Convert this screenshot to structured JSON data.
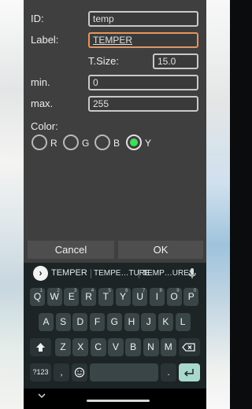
{
  "form": {
    "id_label": "ID:",
    "id_value": "temp",
    "label_label": "Label:",
    "label_value": "TEMPER",
    "tsize_label": "T.Size:",
    "tsize_value": "15.0",
    "min_label": "min.",
    "min_value": "0",
    "max_label": "max.",
    "max_value": "255",
    "color_label": "Color:",
    "colors": [
      {
        "label": "R",
        "checked": false
      },
      {
        "label": "G",
        "checked": false
      },
      {
        "label": "B",
        "checked": false
      },
      {
        "label": "Y",
        "checked": true
      }
    ],
    "selected_color_accent": "#3ee05a"
  },
  "dialog_buttons": {
    "cancel": "Cancel",
    "ok": "OK"
  },
  "keyboard": {
    "suggestions": [
      "TEMPER",
      "TEMPE…TURE",
      "TEMP…URES"
    ],
    "suggestion_icon": "chevron-right-icon",
    "mic_icon": "mic-icon",
    "row1": [
      {
        "k": "Q",
        "h": "1"
      },
      {
        "k": "W",
        "h": "2"
      },
      {
        "k": "E",
        "h": "3"
      },
      {
        "k": "R",
        "h": "4"
      },
      {
        "k": "T",
        "h": "5"
      },
      {
        "k": "Y",
        "h": "6"
      },
      {
        "k": "U",
        "h": "7"
      },
      {
        "k": "I",
        "h": "8"
      },
      {
        "k": "O",
        "h": "9"
      },
      {
        "k": "P",
        "h": "0"
      }
    ],
    "row2": [
      "A",
      "S",
      "D",
      "F",
      "G",
      "H",
      "J",
      "K",
      "L"
    ],
    "row3": [
      "Z",
      "X",
      "C",
      "V",
      "B",
      "N",
      "M"
    ],
    "symbols_label": "?123",
    "comma_label": ",",
    "period_label": ".",
    "shift_icon": "shift-icon",
    "backspace_icon": "backspace-icon",
    "emoji_icon": "emoji-icon",
    "enter_icon": "enter-icon",
    "accent_color": "#a9d9cc"
  },
  "navbar": {
    "back_icon": "chevron-down-icon"
  }
}
